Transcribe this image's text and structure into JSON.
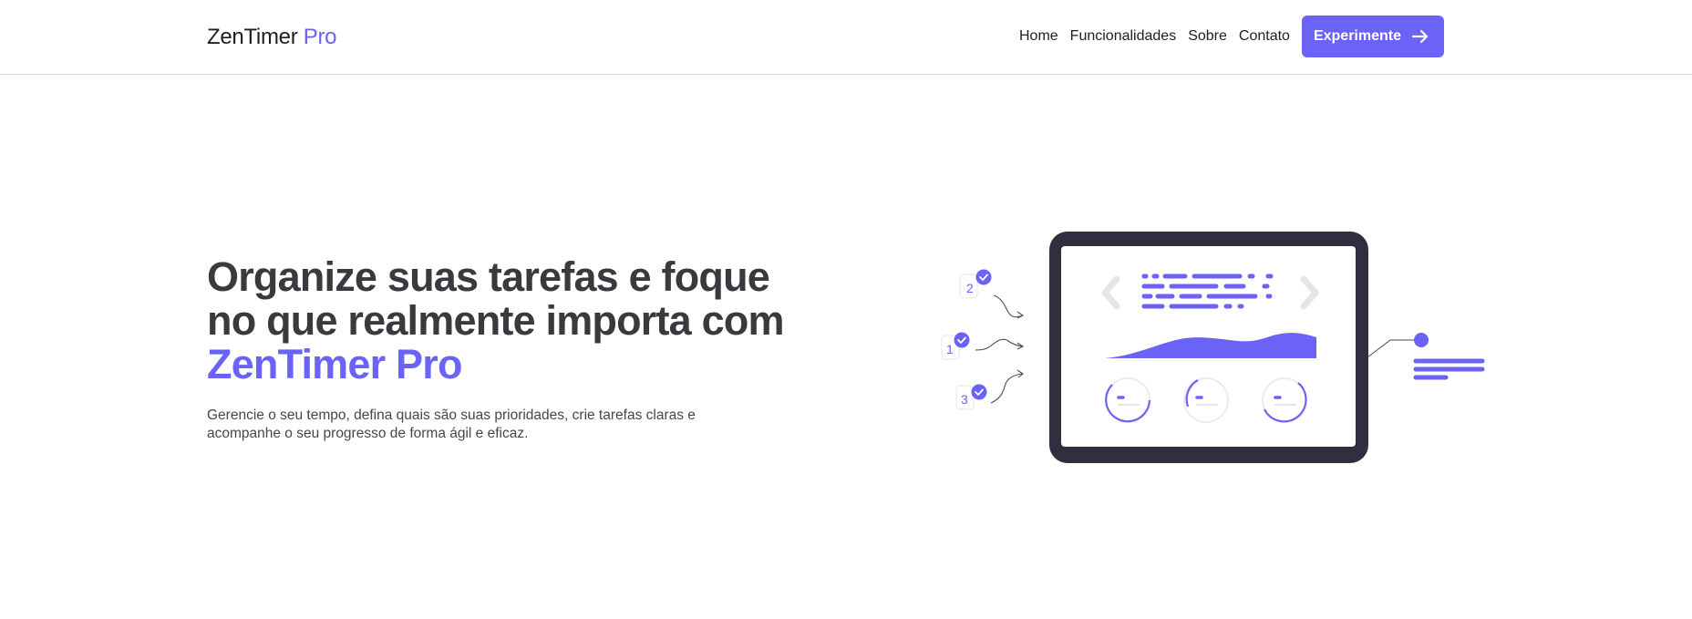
{
  "header": {
    "brand": {
      "name": "ZenTimer",
      "accent": "Pro"
    },
    "nav": [
      {
        "label": "Home"
      },
      {
        "label": "Funcionalidades"
      },
      {
        "label": "Sobre"
      },
      {
        "label": "Contato"
      }
    ],
    "cta_label": "Experimente",
    "cta_icon": "arrow-right-icon"
  },
  "hero": {
    "title_main": "Organize suas tarefas e foque no que realmente importa com ",
    "title_accent": "ZenTimer Pro",
    "subtitle": "Gerencie o seu tempo, defina quais são suas prioridades, crie tarefas claras e acompanhe o seu progresso de forma ágil e eficaz."
  },
  "illustration": {
    "step_numbers": [
      "2",
      "1",
      "3"
    ]
  },
  "colors": {
    "accent": "#6a63f6",
    "text_dark": "#3a3a3e",
    "device_frame": "#302f3f",
    "muted_gray": "#e5e5e8"
  }
}
